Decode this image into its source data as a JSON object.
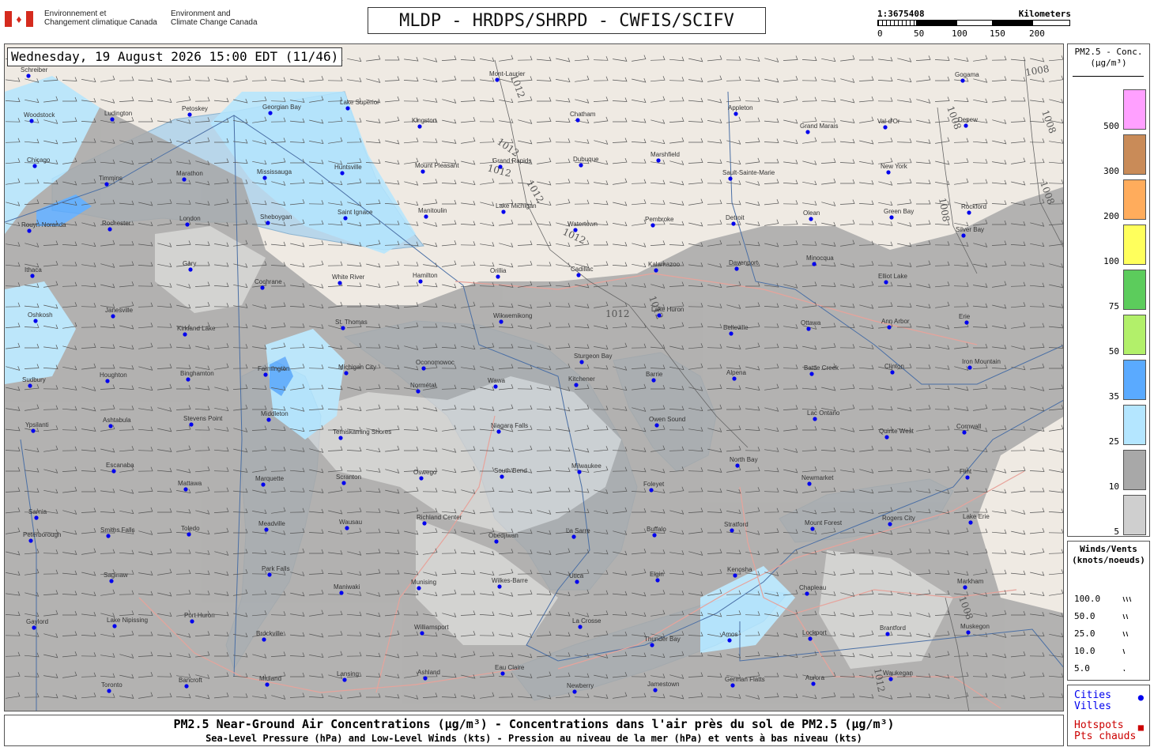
{
  "header": {
    "dept_fr": [
      "Environnement et",
      "Changement climatique Canada"
    ],
    "dept_en": [
      "Environment and",
      "Climate Change Canada"
    ],
    "title": "MLDP - HRDPS/SHRPD - CWFIS/SCIFV",
    "scale": {
      "ratio": "1:3675408",
      "unit": "Kilometers",
      "ticks": [
        "0",
        "50",
        "100",
        "150",
        "200"
      ]
    }
  },
  "map": {
    "datetime": "Wednesday, 19 August 2026 15:00 EDT (11/46)",
    "isobars": [
      "1012",
      "1012",
      "1012",
      "1012",
      "1012",
      "1012",
      "1012",
      "1008",
      "1008",
      "1008",
      "1008",
      "1008",
      "1008",
      "1012"
    ],
    "places": [
      "Schreiber",
      "Marathon",
      "White River",
      "Wawa",
      "Foleyet",
      "Chapleau",
      "Gogama",
      "Timmins",
      "Cochrane",
      "Normétal",
      "La Sarre",
      "Amos",
      "Val-d'Or",
      "Rouyn-Noranda",
      "Kirkland Lake",
      "Temiskaming Shores",
      "Obedjiwan",
      "Thunder Bay",
      "Grand Marais",
      "Silver Bay",
      "Houghton",
      "Marquette",
      "Munising",
      "Newberry",
      "Sault-Sainte-Marie",
      "Elliot Lake",
      "Sudbury",
      "Mattawa",
      "Maniwaki",
      "Mont-Laurier",
      "Pembroke",
      "Ottawa",
      "Cornwall",
      "Smiths Falls",
      "Brockville",
      "Kingston",
      "Watertown",
      "Belleville",
      "Quinte West",
      "Peterborough",
      "Bancroft",
      "Huntsville",
      "Orillia",
      "Barrie",
      "Newmarket",
      "Markham",
      "Toronto",
      "Mississauga",
      "Hamilton",
      "Kitchener",
      "Stratford",
      "Brantford",
      "Woodstock",
      "London",
      "St. Thomas",
      "Niagara Falls",
      "Buffalo",
      "Lockport",
      "Depew",
      "Rochester",
      "Farmington",
      "Oswego",
      "Utica",
      "German Flatts",
      "New York",
      "Ithaca",
      "Binghamton",
      "Scranton",
      "Wilkes-Barre",
      "Jamestown",
      "Olean",
      "Erie",
      "Ashtabula",
      "Meadville",
      "Williamsport",
      "Chatham",
      "Detroit",
      "Ann Arbor",
      "Ypsilanti",
      "Toledo",
      "Lansing",
      "Grand Rapids",
      "Kalamazoo",
      "Battle Creek",
      "Flint",
      "Saginaw",
      "Midland",
      "Mount Pleasant",
      "Cadillac",
      "Alpena",
      "Rogers City",
      "Gaylord",
      "Petoskey",
      "Saint Ignace",
      "Wikwemikong",
      "Owen Sound",
      "Mount Forest",
      "Muskegon",
      "Ludington",
      "Sheboygan",
      "Oconomowoc",
      "Milwaukee",
      "Kenosha",
      "Waukegan",
      "Chicago",
      "Gary",
      "Michigan City",
      "South Bend",
      "Elgin",
      "Aurora",
      "Rockford",
      "Janesville",
      "Middleton",
      "Richland Center",
      "La Crosse",
      "Appleton",
      "Green Bay",
      "Oshkosh",
      "Stevens Point",
      "Wausau",
      "Eau Claire",
      "Marshfield",
      "Minocqua",
      "Iron Mountain",
      "Escanaba",
      "Park Falls",
      "Ashland",
      "Dubuque",
      "Davenport",
      "Clinton",
      "Sarnia",
      "Port Huron",
      "Lake Superior",
      "Lake Michigan",
      "Lake Huron",
      "Lac Ontario",
      "Lake Erie",
      "Lake Nipissing",
      "Georgian Bay",
      "Manitoulin",
      "Sturgeon Bay",
      "North Bay"
    ]
  },
  "legend_pm": {
    "title": [
      "PM2.5 - Conc.",
      "(µg/m³)"
    ],
    "items": [
      {
        "label": "500",
        "color": "#ffa0ff"
      },
      {
        "label": "300",
        "color": "#c98b58"
      },
      {
        "label": "200",
        "color": "#ffac5c"
      },
      {
        "label": "100",
        "color": "#ffff5c"
      },
      {
        "label": "75",
        "color": "#5ccc5c"
      },
      {
        "label": "50",
        "color": "#b2f06a"
      },
      {
        "label": "35",
        "color": "#5aaaff"
      },
      {
        "label": "25",
        "color": "#b4e6ff"
      },
      {
        "label": "10",
        "color": "#a8a8a8"
      },
      {
        "label": "5",
        "color": "#cfcfcf"
      }
    ]
  },
  "legend_wind": {
    "title": [
      "Winds/Vents",
      "(knots/noeuds)"
    ],
    "items": [
      "100.0",
      "50.0",
      "25.0",
      "10.0",
      "5.0"
    ]
  },
  "legend_places": {
    "cities": [
      "Cities",
      "Villes"
    ],
    "hotspots": [
      "Hotspots",
      "Pts chauds"
    ],
    "city_color": "#0000ee",
    "hotspot_color": "#cc0000"
  },
  "footer": {
    "line1": "PM2.5 Near-Ground Air Concentrations (µg/m³) - Concentrations dans l'air près du sol de PM2.5 (µg/m³)",
    "line2": "Sea-Level Pressure (hPa) and Low-Level Winds (kts) - Pression au niveau de la mer (hPa) et vents à bas niveau (kts)"
  }
}
